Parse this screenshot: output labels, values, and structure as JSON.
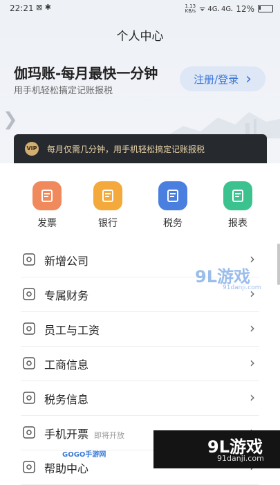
{
  "status_bar": {
    "time": "22:21",
    "left_icons": "⊠ ✱",
    "net_speed_top": "1.13",
    "net_speed_bottom": "KB/s",
    "signal": "ᯤ 4G᎐ 4G᎐",
    "battery": "12%"
  },
  "header": {
    "title": "个人中心"
  },
  "hero": {
    "heading": "伽玛账-每月最快一分钟",
    "subtitle": "用手机轻松搞定记账报税",
    "login_label": "注册/登录",
    "login_chevron": "›"
  },
  "vip": {
    "badge": "VIP",
    "text": "每月仅需几分钟，用手机轻松搞定记账报税"
  },
  "quick_actions": [
    {
      "label": "发票",
      "icon": "invoice-icon",
      "color": "#f08a5d"
    },
    {
      "label": "银行",
      "icon": "bank-icon",
      "color": "#f3a93b"
    },
    {
      "label": "税务",
      "icon": "tax-icon",
      "color": "#4a7fe0"
    },
    {
      "label": "报表",
      "icon": "report-icon",
      "color": "#3cc28f"
    }
  ],
  "menu": [
    {
      "label": "新增公司",
      "sub": "",
      "icon": "add-company-icon"
    },
    {
      "label": "专属财务",
      "sub": "",
      "icon": "diamond-icon"
    },
    {
      "label": "员工与工资",
      "sub": "",
      "icon": "staff-icon"
    },
    {
      "label": "工商信息",
      "sub": "",
      "icon": "shield-icon"
    },
    {
      "label": "税务信息",
      "sub": "",
      "icon": "tax-info-icon"
    },
    {
      "label": "手机开票",
      "sub": "即将开放",
      "icon": "mobile-invoice-icon"
    },
    {
      "label": "帮助中心",
      "sub": "",
      "icon": "help-icon"
    }
  ],
  "watermarks": {
    "wm1_big": "9L游戏",
    "wm1_small": "91danji.com",
    "wm2_big": "9L游戏",
    "wm2_small": "91danji.com",
    "wm3": "GOGO手游网"
  },
  "colors": {
    "accent": "#3b76d8",
    "hero_bg": "#eef1f6",
    "vip_bg": "#26292e",
    "vip_text": "#e8d3a7"
  }
}
